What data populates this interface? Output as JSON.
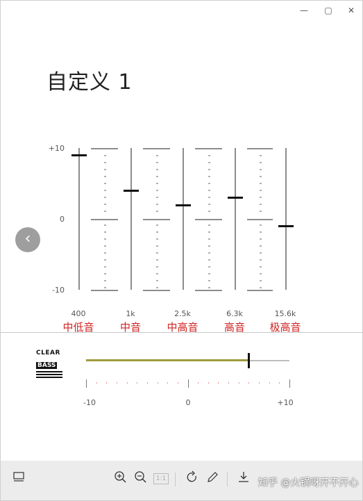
{
  "window": {
    "buttons": [
      "—",
      "▢",
      "✕"
    ]
  },
  "title": "自定义 1",
  "eq": {
    "scale_labels": {
      "top": "+10",
      "mid": "0",
      "bottom": "-10"
    },
    "range": [
      -10,
      10
    ],
    "bands": [
      {
        "freq": "400",
        "name": "中低音",
        "value": 9
      },
      {
        "freq": "1k",
        "name": "中音",
        "value": 4
      },
      {
        "freq": "2.5k",
        "name": "中高音",
        "value": 2
      },
      {
        "freq": "6.3k",
        "name": "高音",
        "value": 3
      },
      {
        "freq": "15.6k",
        "name": "极高音",
        "value": -1
      }
    ]
  },
  "clearbass": {
    "logo_line1": "CLEAR",
    "logo_line2": "BASS",
    "value": 6,
    "range": [
      -10,
      10
    ],
    "labels": {
      "min": "-10",
      "mid": "0",
      "max": "+10"
    }
  },
  "toolbar": {
    "fit_label": "1:1",
    "watermark": "知乎 @火锅呀开不开心"
  },
  "colors": {
    "band_name": "#d12222",
    "bass_fill": "#9e9a3c"
  }
}
